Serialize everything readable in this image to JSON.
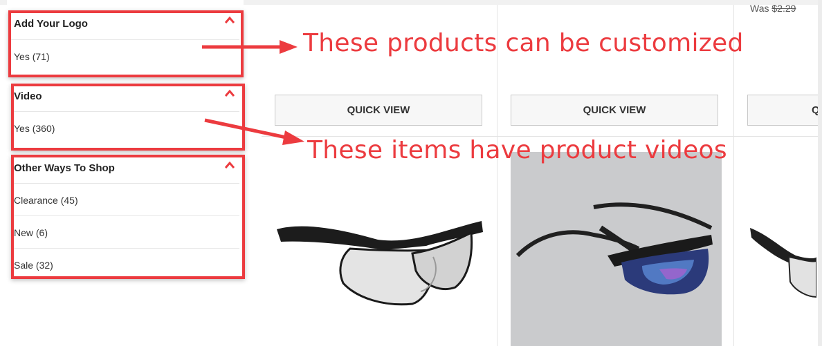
{
  "filters": [
    {
      "title": "Add Your Logo",
      "items": [
        "Yes (71)"
      ]
    },
    {
      "title": "Video",
      "items": [
        "Yes (360)"
      ]
    },
    {
      "title": "Other Ways To Shop",
      "items": [
        "Clearance (45)",
        "New (6)",
        "Sale (32)"
      ]
    }
  ],
  "products": [
    {
      "quick_view": "QUICK VIEW"
    },
    {
      "quick_view": "QUICK VIEW"
    },
    {
      "quick_view": "Q"
    }
  ],
  "price": {
    "label": "Was",
    "value": "$2.29"
  },
  "annotations": {
    "customized": "These products can be customized",
    "videos": "These items have product videos"
  },
  "colors": {
    "highlight": "#ec3b3f",
    "annotation_text": "#ec3b3f"
  }
}
